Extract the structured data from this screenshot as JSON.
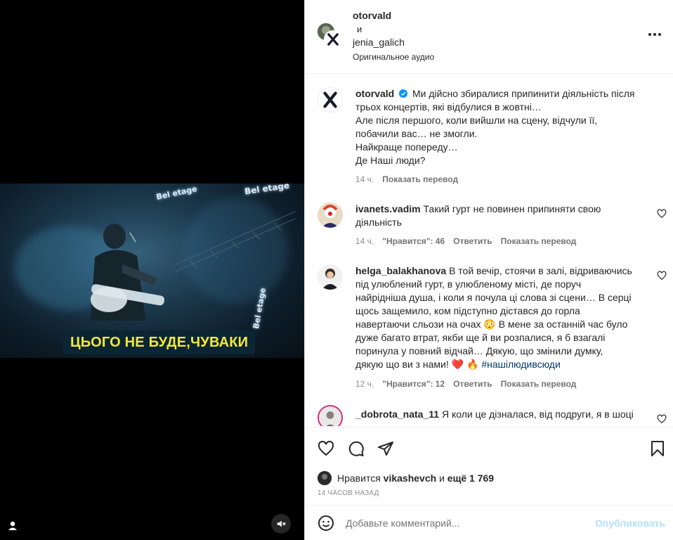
{
  "video": {
    "caption": "ЦЬОГО НЕ БУДЕ,ЧУВАКИ",
    "neon_sign": "Bel etage"
  },
  "header": {
    "author1": "otorvald",
    "conjunction": "и",
    "author2": "jenia_galich",
    "audio": "Оригинальное аудио"
  },
  "post": {
    "username": "otorvald",
    "lines": [
      "Ми дійсно збиралися припинити діяльність після",
      "трьох концертів, які відбулися в жовтні…",
      "Але після першого, коли вийшли на сцену, відчули її,",
      "побачили вас… не змогли.",
      "Найкраще попереду…",
      "Де Наші люди?"
    ],
    "time": "14 ч.",
    "translate": "Показать перевод"
  },
  "comments": [
    {
      "username": "ivanets.vadim",
      "lines": [
        "Такий гурт не повинен припиняти свою",
        "діяльність"
      ],
      "time": "14 ч.",
      "likes": "\"Нравится\": 46",
      "reply": "Ответить",
      "translate": "Показать перевод"
    },
    {
      "username": "helga_balakhanova",
      "lines": [
        "В той вечір, стоячи в залі, відриваючись",
        "під улюблений гурт, в улюбленому місті, де поруч",
        "найрідніша душа, і коли я почула ці слова зі сцени… В серці",
        "щось защемило, ком підступно дістався до горла",
        "навертаючи сльози на очах",
        "В мене за останній час було",
        "дуже багато втрат, якби ще й ви розпалися, я б взагалі",
        "поринула у повний відчай… Дякую, що змінили думку,",
        "дякую що ви з нами!"
      ],
      "emoji": "😳",
      "heart_emoji": "❤️",
      "fire_emoji": "🔥",
      "hashtag": "#нашілюдивсюди",
      "time": "12 ч.",
      "likes": "\"Нравится\": 12",
      "reply": "Ответить",
      "translate": "Показать перевод"
    },
    {
      "username": "_dobrota_nata_11",
      "lines": [
        "Я коли це дізналася, від подруги, я в шоці"
      ]
    }
  ],
  "likes_row": {
    "prefix": "Нравится",
    "user": "vikashevch",
    "and": "и",
    "more": "ещё 1 769"
  },
  "posted_ago": "14 ЧАСОВ НАЗАД",
  "add_comment": {
    "placeholder": "Добавьте комментарий...",
    "publish": "Опубликовать"
  },
  "colors": {
    "caption_yellow": "#f3e93b",
    "verified_blue": "#0095f6",
    "publish_disabled": "#b2dffc",
    "link_dark": "#00376b"
  },
  "icons": [
    "more-icon",
    "verified-icon",
    "heart-icon",
    "comment-icon",
    "share-icon",
    "bookmark-icon",
    "emoji-icon",
    "user-icon",
    "mute-icon"
  ]
}
